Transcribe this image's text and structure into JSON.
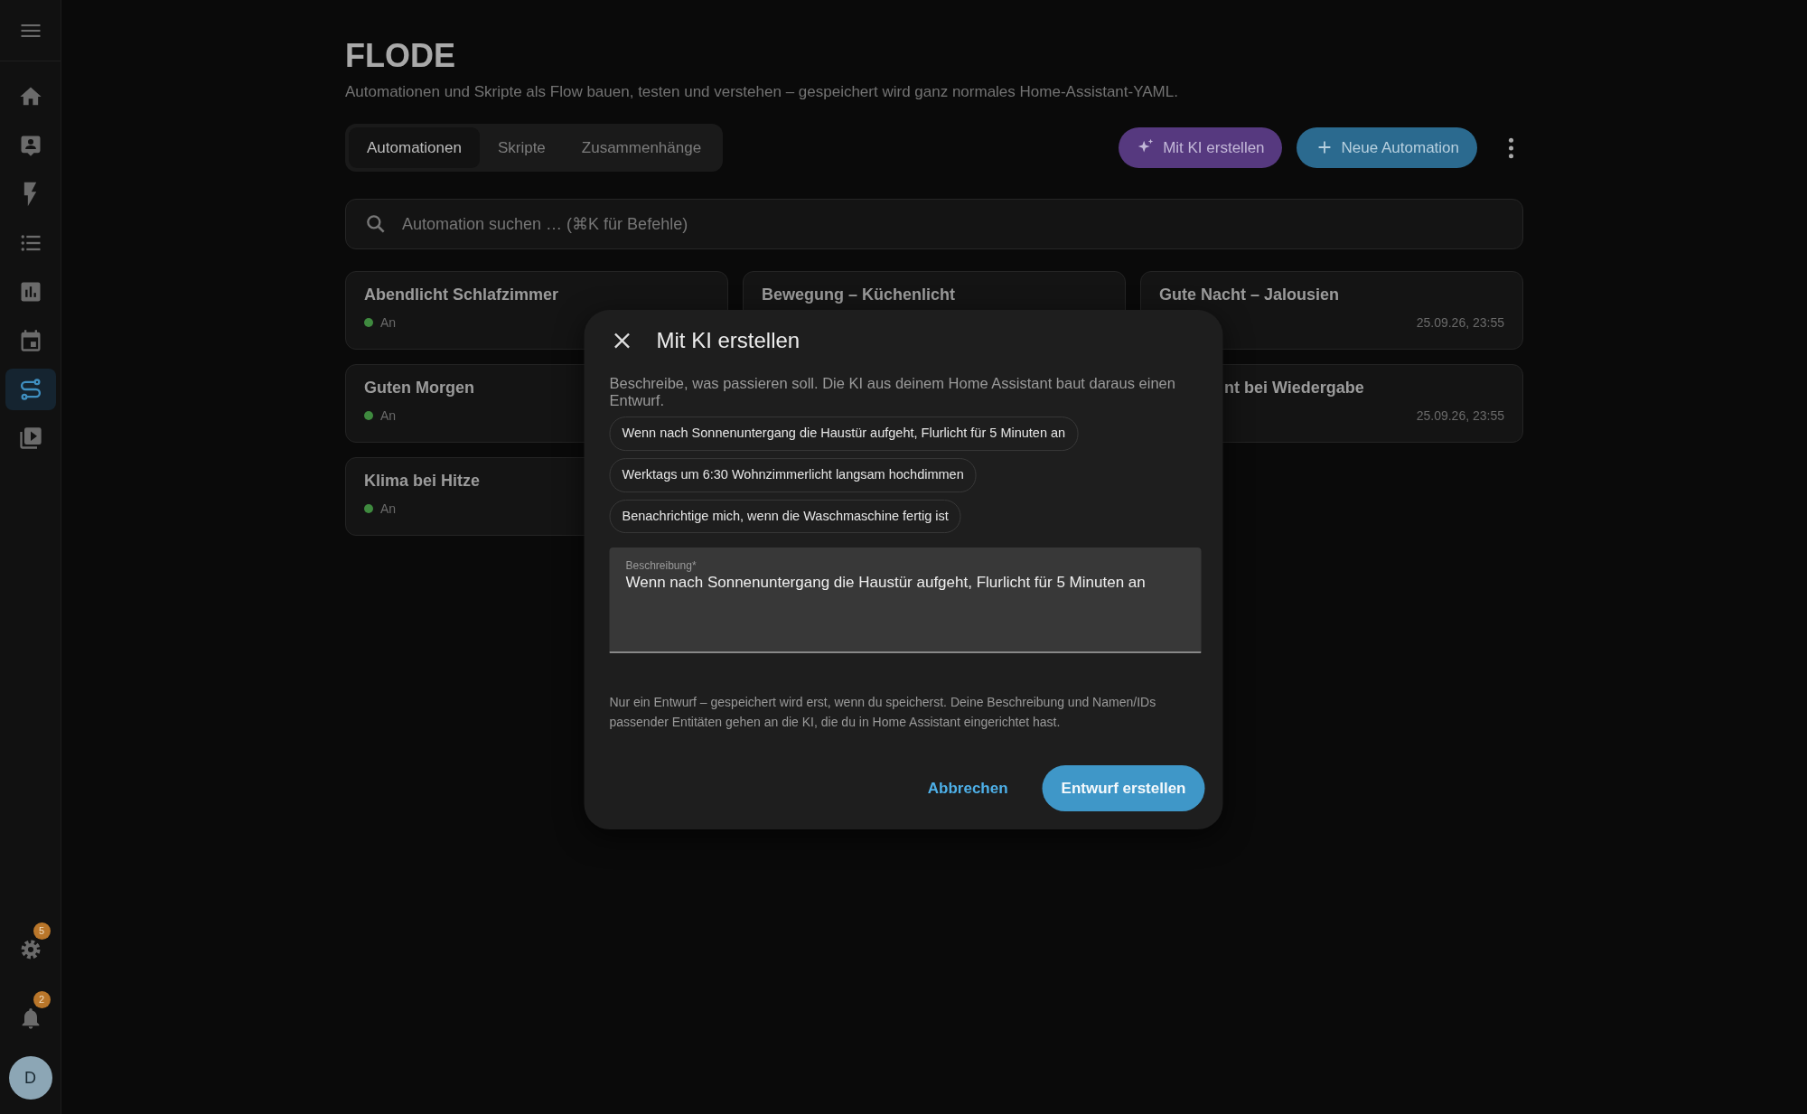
{
  "sidebar": {
    "items": [
      {
        "kind": "home",
        "selected": false
      },
      {
        "kind": "person-card",
        "selected": false
      },
      {
        "kind": "bolt",
        "selected": false
      },
      {
        "kind": "list",
        "selected": false
      },
      {
        "kind": "chart",
        "selected": false
      },
      {
        "kind": "calendar",
        "selected": false
      },
      {
        "kind": "flow",
        "selected": true
      },
      {
        "kind": "media",
        "selected": false
      }
    ],
    "settings_badge": "5",
    "notifications_badge": "2",
    "avatar": "D"
  },
  "header": {
    "title": "FLODE",
    "subtitle": "Automationen und Skripte als Flow bauen, testen und verstehen – gespeichert wird ganz normales Home-Assistant-YAML."
  },
  "tabs": [
    {
      "label": "Automationen",
      "selected": true
    },
    {
      "label": "Skripte",
      "selected": false
    },
    {
      "label": "Zusammenhänge",
      "selected": false
    }
  ],
  "actions": {
    "ai_button": "Mit KI erstellen",
    "new_button": "Neue Automation"
  },
  "search": {
    "placeholder": "Automation suchen … (⌘K für Befehle)"
  },
  "card_columns": [
    [
      {
        "title": "Abendlicht Schlafzimmer",
        "status": "An",
        "on": true
      },
      {
        "title": "Guten Morgen",
        "status": "An",
        "on": true
      },
      {
        "title": "Klima bei Hitze",
        "status": "An",
        "on": true
      }
    ],
    [
      {
        "title": "Bewegung – Küchenlicht"
      }
    ],
    [
      {
        "title": "Gute Nacht – Jalousien",
        "date": "25.09.26, 23:55"
      },
      {
        "title": "nt bei Wiedergabe",
        "date": "25.09.26, 23:55",
        "clipped": true
      }
    ]
  ],
  "dialog": {
    "title": "Mit KI erstellen",
    "description": "Beschreibe, was passieren soll. Die KI aus deinem Home Assistant baut daraus einen Entwurf.",
    "suggestions": [
      "Wenn nach Sonnenuntergang die Haustür aufgeht, Flurlicht für 5 Minuten an",
      "Werktags um 6:30 Wohnzimmerlicht langsam hochdimmen",
      "Benachrichtige mich, wenn die Waschmaschine fertig ist"
    ],
    "field": {
      "label": "Beschreibung*",
      "value": "Wenn nach Sonnenuntergang die Haustür aufgeht, Flurlicht für 5 Minuten an"
    },
    "note": "Nur ein Entwurf – gespeichert wird erst, wenn du speicherst. Deine Beschreibung und Namen/IDs passender Entitäten gehen an die KI, die du in Home Assistant eingerichtet hast.",
    "cancel": "Abbrechen",
    "confirm": "Entwurf erstellen"
  }
}
